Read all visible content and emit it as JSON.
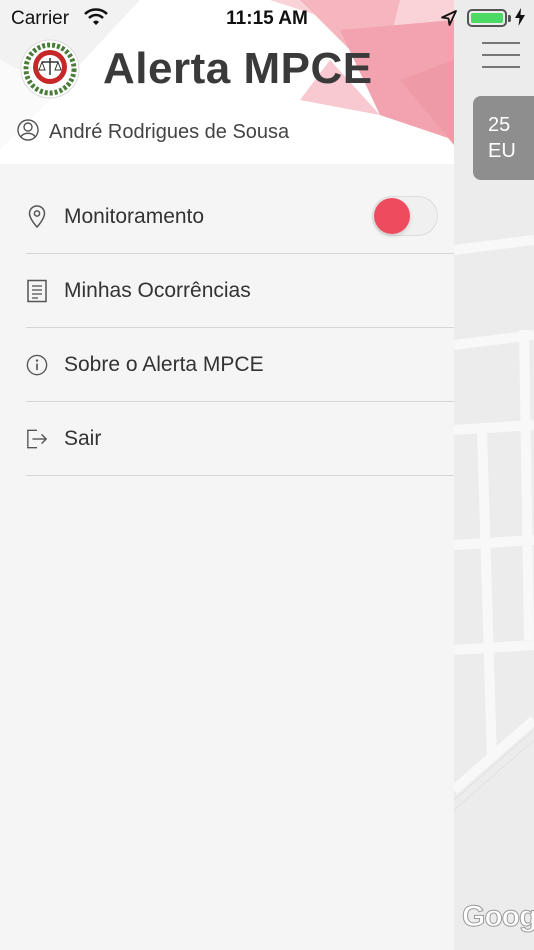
{
  "status_bar": {
    "carrier": "Carrier",
    "time": "11:15 AM",
    "battery_color": "#4cd964"
  },
  "drawer": {
    "app_title": "Alerta MPCE",
    "user_name": "André Rodrigues de Sousa",
    "accent_color": "#ef4b5f",
    "menu": [
      {
        "label": "Monitoramento",
        "icon": "location-pin-icon",
        "toggle_on": true
      },
      {
        "label": "Minhas Ocorrências",
        "icon": "document-list-icon"
      },
      {
        "label": "Sobre o Alerta MPCE",
        "icon": "info-icon"
      },
      {
        "label": "Sair",
        "icon": "logout-icon"
      }
    ]
  },
  "map": {
    "card_line1": "25",
    "card_line2": "EU",
    "attribution": "Goog"
  }
}
